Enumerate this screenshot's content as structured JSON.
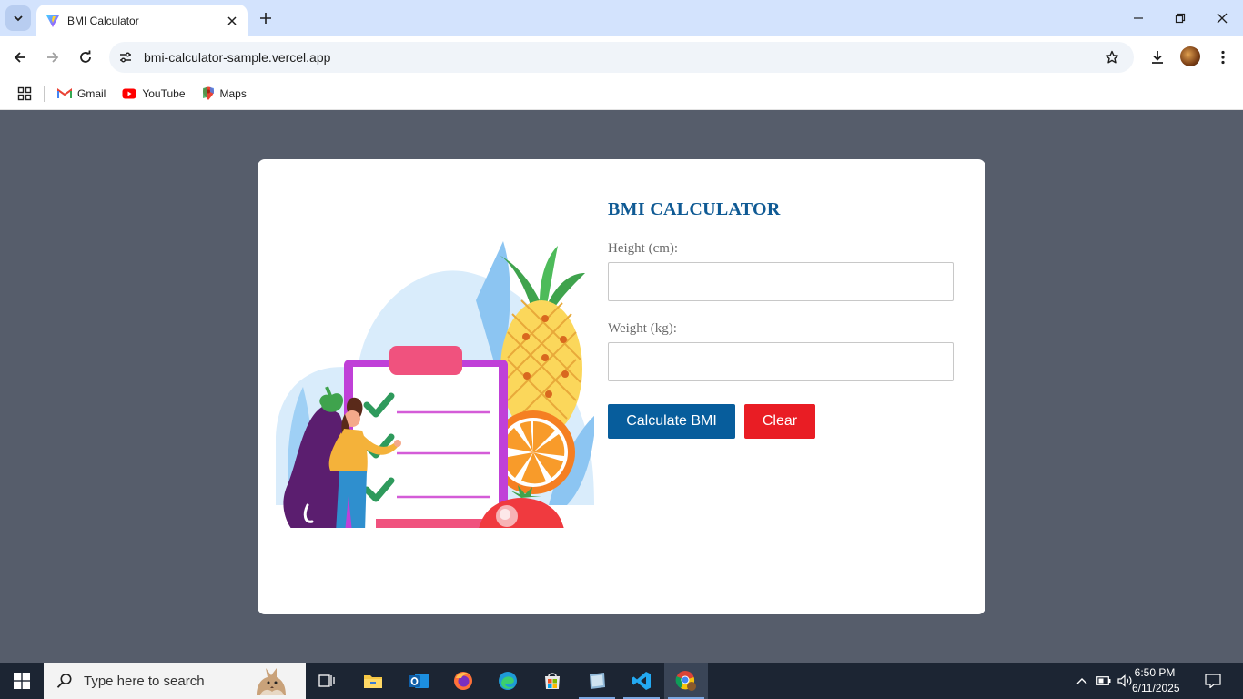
{
  "browser": {
    "tab_title": "BMI Calculator",
    "url": "bmi-calculator-sample.vercel.app",
    "bookmarks": [
      {
        "label": "Gmail",
        "icon": "gmail-icon"
      },
      {
        "label": "YouTube",
        "icon": "youtube-icon"
      },
      {
        "label": "Maps",
        "icon": "maps-icon"
      }
    ]
  },
  "app": {
    "title": "BMI CALCULATOR",
    "height_label": "Height (cm):",
    "height_value": "",
    "weight_label": "Weight (kg):",
    "weight_value": "",
    "calculate_label": "Calculate BMI",
    "clear_label": "Clear",
    "colors": {
      "title": "#0f5a94",
      "calculate_bg": "#075d9c",
      "clear_bg": "#e91d24",
      "page_bg": "#565d6b"
    }
  },
  "taskbar": {
    "search_placeholder": "Type here to search",
    "time": "6:50 PM",
    "date": "6/11/2025"
  }
}
